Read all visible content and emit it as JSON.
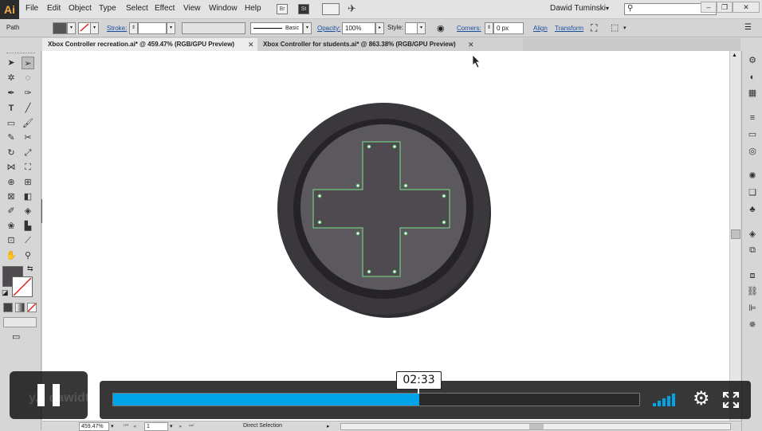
{
  "app": {
    "logo": "Ai",
    "menus": [
      "File",
      "Edit",
      "Object",
      "Type",
      "Select",
      "Effect",
      "View",
      "Window",
      "Help"
    ],
    "mini_buttons": [
      "Br",
      "St"
    ],
    "user": "Dawid Tuminski",
    "user_caret": "▾",
    "window_buttons": [
      "–",
      "❐",
      "✕"
    ]
  },
  "control_bar": {
    "selection_label": "Path",
    "stroke_label": "Stroke:",
    "stroke_style": "Basic",
    "opacity_label": "Opacity:",
    "opacity_value": "100%",
    "style_label": "Style:",
    "corners_label": "Corners:",
    "corners_value": "0 px",
    "align_label": "Align",
    "transform_label": "Transform"
  },
  "tabs": [
    {
      "label": "Xbox Controller recreation.ai* @ 459.47% (RGB/GPU Preview)",
      "close": "✕"
    },
    {
      "label": "Xbox Controller for students.ai* @ 863.38% (RGB/GPU Preview)",
      "close": "✕"
    }
  ],
  "status_bar": {
    "zoom": "459.47%",
    "artboard": "1",
    "tool_label": "Direct Selection"
  },
  "player": {
    "timestamp": "02:33",
    "progress": 0.582,
    "watermark": "y... dawidtu..."
  },
  "colors": {
    "progress": "#00a2e8",
    "canvas_dpad": "#4e4a4f",
    "selection": "#7be38a"
  }
}
